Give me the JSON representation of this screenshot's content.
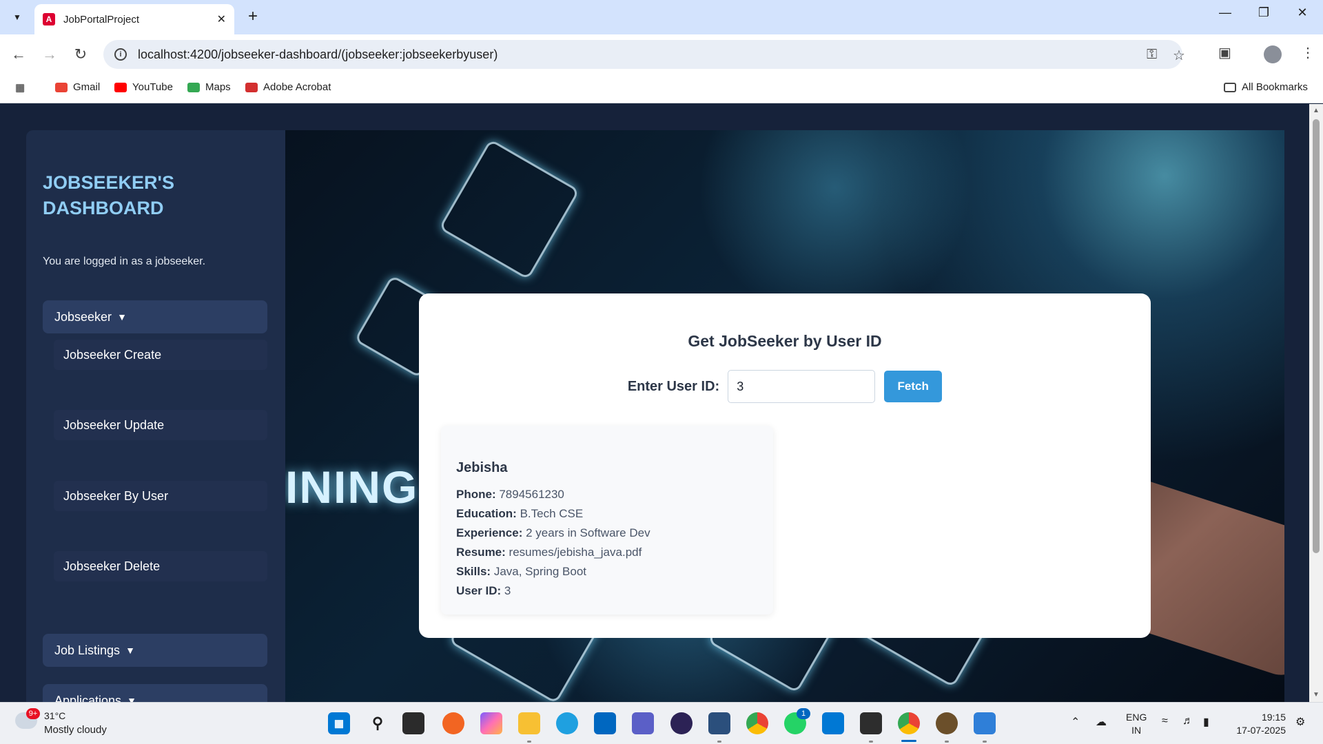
{
  "browser": {
    "tab_title": "JobPortalProject",
    "url": "localhost:4200/jobseeker-dashboard/(jobseeker:jobseekerbyuser)",
    "bookmarks": [
      "Gmail",
      "YouTube",
      "Maps",
      "Adobe Acrobat"
    ],
    "all_bookmarks": "All Bookmarks"
  },
  "sidebar": {
    "title": "JOBSEEKER'S DASHBOARD",
    "logged_in": "You are logged in as a jobseeker.",
    "groups": [
      {
        "label": "Jobseeker",
        "expanded": true,
        "items": [
          "Jobseeker Create",
          "Jobseeker Update",
          "Jobseeker By User",
          "Jobseeker Delete"
        ]
      },
      {
        "label": "Job Listings",
        "expanded": false
      },
      {
        "label": "Applications",
        "expanded": false
      }
    ]
  },
  "hero": {
    "background_text": "INING"
  },
  "form": {
    "title": "Get JobSeeker by User ID",
    "label": "Enter User ID:",
    "value": "3",
    "button": "Fetch",
    "button_color": "#3498db"
  },
  "result": {
    "name": "Jebisha",
    "fields": [
      {
        "label": "Phone:",
        "value": "7894561230"
      },
      {
        "label": "Education:",
        "value": "B.Tech CSE"
      },
      {
        "label": "Experience:",
        "value": "2 years in Software Dev"
      },
      {
        "label": "Resume:",
        "value": "resumes/jebisha_java.pdf"
      },
      {
        "label": "Skills:",
        "value": "Java, Spring Boot"
      },
      {
        "label": "User ID:",
        "value": "3"
      }
    ]
  },
  "taskbar": {
    "weather_badge": "9+",
    "temperature": "31°C",
    "weather": "Mostly cloudy",
    "teams_badge": "1",
    "lang_1": "ENG",
    "lang_2": "IN",
    "time": "19:15",
    "date": "17-07-2025"
  }
}
